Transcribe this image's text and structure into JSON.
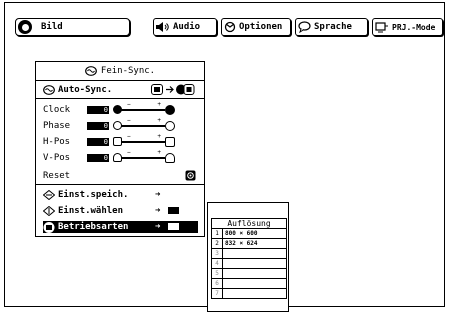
{
  "tabs": [
    {
      "label": "Bild",
      "icon": "bild-icon"
    },
    {
      "label": "Audio",
      "icon": "speaker-icon"
    },
    {
      "label": "Optionen",
      "icon": "optionen-icon"
    },
    {
      "label": "Sprache",
      "icon": "speech-bubble-icon"
    },
    {
      "label": "PRJ.-Mode",
      "icon": "projector-mode-icon"
    }
  ],
  "panel": {
    "title": "Fein-Sync.",
    "auto_sync": "Auto-Sync.",
    "bars": [
      {
        "label": "Clock",
        "value": "0"
      },
      {
        "label": "Phase",
        "value": "0"
      },
      {
        "label": "H-Pos",
        "value": "0"
      },
      {
        "label": "V-Pos",
        "value": "0"
      }
    ],
    "reset": "Reset",
    "menu": [
      {
        "label": "Einst.speich."
      },
      {
        "label": "Einst.wählen"
      },
      {
        "label": "Betriebsarten"
      }
    ]
  },
  "resolution_popup": {
    "title": "Auflösung",
    "rows": [
      {
        "num": "1",
        "value": "800 × 600"
      },
      {
        "num": "2",
        "value": "832 × 624"
      },
      {
        "num": "3",
        "value": ""
      },
      {
        "num": "4",
        "value": ""
      },
      {
        "num": "5",
        "value": ""
      },
      {
        "num": "6",
        "value": ""
      },
      {
        "num": "7",
        "value": ""
      }
    ]
  }
}
